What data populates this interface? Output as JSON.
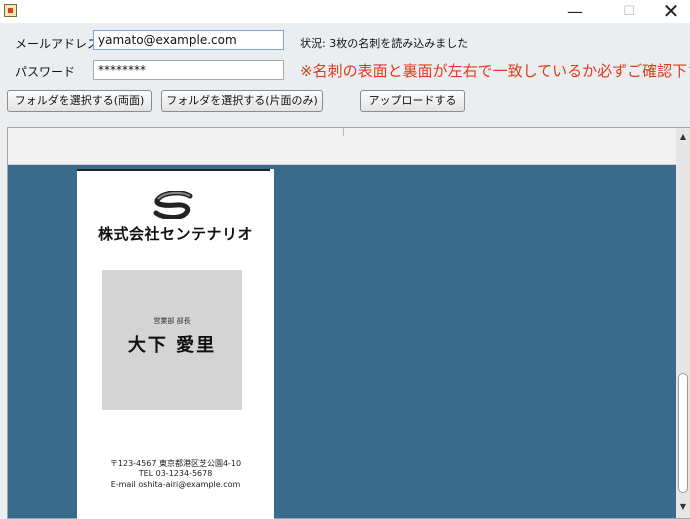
{
  "window": {
    "minimize_label": "—",
    "maximize_label": "☐",
    "close_label": "✕"
  },
  "form": {
    "email_label": "メールアドレス",
    "email_value": "yamato@example.com",
    "password_label": "パスワード",
    "password_value": "********",
    "status_text": "状況: 3枚の名刺を読み込みました",
    "warning_text": "※名刺の表面と裏面が左右で一致しているか必ずご確認下さい"
  },
  "buttons": {
    "select_folder_double": "フォルダを選択する(両面)",
    "select_folder_single": "フォルダを選択する(片面のみ)",
    "upload": "アップロードする"
  },
  "card": {
    "company": "株式会社センテナリオ",
    "role": "営業部 部長",
    "name": "大下 愛里",
    "address": "〒123-4567 東京都港区芝公園4-10",
    "tel": "TEL 03-1234-5678",
    "email": "E-mail oshita-airi@example.com"
  },
  "scrollbar": {
    "up_icon": "▲",
    "down_icon": "▼"
  },
  "colors": {
    "pane_background": "#3b6b8a",
    "warning": "#e03a16"
  }
}
